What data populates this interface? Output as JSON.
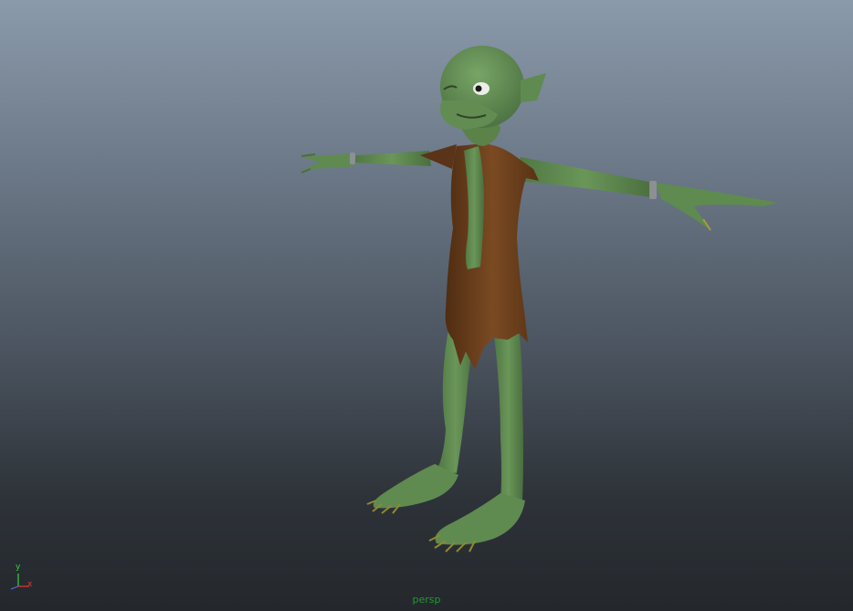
{
  "viewport": {
    "camera_label": "persp",
    "label_color": "#1f9a2e"
  },
  "axis_gizmo": {
    "y_label": "y",
    "x_label": "x",
    "y_color": "#37d43c",
    "x_color": "#e03a30",
    "z_color": "#4a6bff"
  },
  "model": {
    "skin_color": "#5f8a50",
    "clothing_color": "#6b3f1c"
  }
}
